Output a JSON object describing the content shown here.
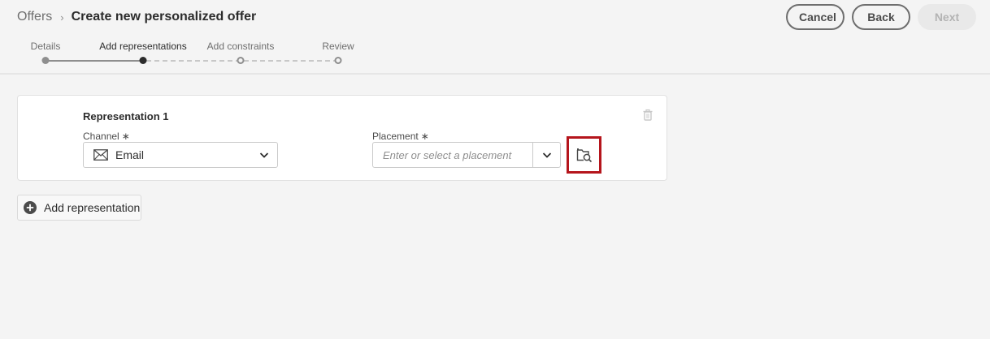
{
  "breadcrumb": {
    "root": "Offers",
    "separator": "›",
    "current": "Create new personalized offer"
  },
  "actions": {
    "cancel": "Cancel",
    "back": "Back",
    "next": "Next"
  },
  "stepper": {
    "steps": [
      {
        "label": "Details",
        "state": "done"
      },
      {
        "label": "Add representations",
        "state": "current"
      },
      {
        "label": "Add constraints",
        "state": "todo"
      },
      {
        "label": "Review",
        "state": "todo"
      }
    ]
  },
  "representation": {
    "title": "Representation 1",
    "channel": {
      "label": "Channel",
      "required_mark": "∗",
      "value": "Email",
      "icon": "mail-icon"
    },
    "placement": {
      "label": "Placement",
      "required_mark": "∗",
      "value": "",
      "placeholder": "Enter or select a placement"
    },
    "browse_icon": "folder-search-icon",
    "delete_icon": "trash-icon"
  },
  "add_representation": {
    "label": "Add representation",
    "icon": "add-circle-icon"
  },
  "colors": {
    "highlight": "#b5151c",
    "background": "#f4f4f4",
    "card": "#ffffff"
  }
}
